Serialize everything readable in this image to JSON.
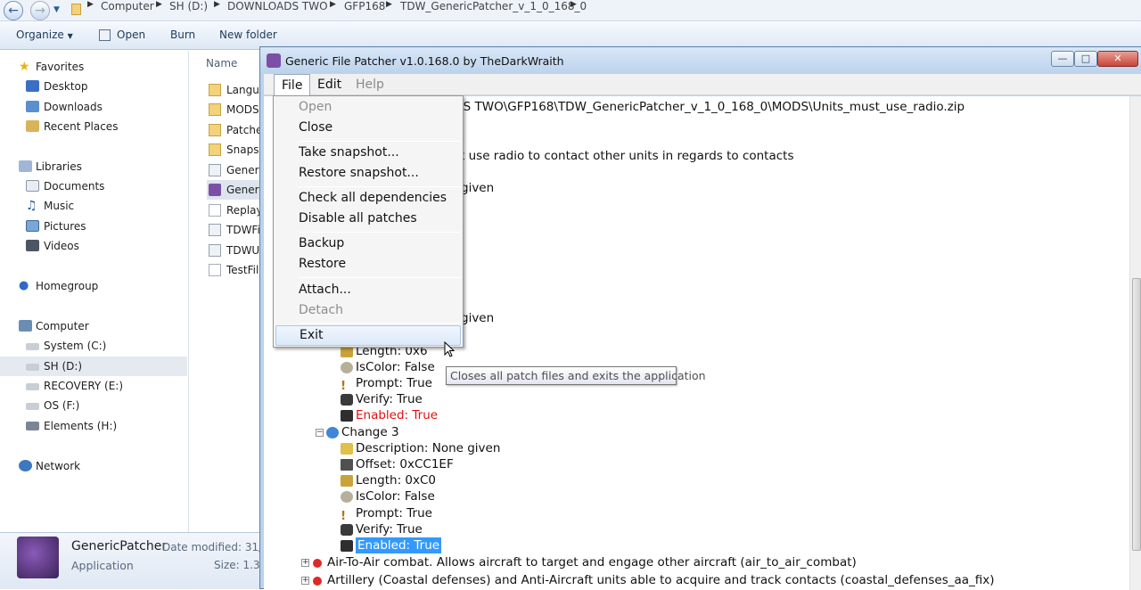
{
  "explorer": {
    "breadcrumb": [
      "Computer",
      "SH (D:)",
      "DOWNLOADS TWO",
      "GFP168",
      "TDW_GenericPatcher_v_1_0_168_0"
    ],
    "toolbar": {
      "organize": "Organize",
      "open": "Open",
      "burn": "Burn",
      "new_folder": "New folder"
    },
    "nav": {
      "favorites": "Favorites",
      "desktop": "Desktop",
      "downloads": "Downloads",
      "recent": "Recent Places",
      "libraries": "Libraries",
      "documents": "Documents",
      "music": "Music",
      "pictures": "Pictures",
      "videos": "Videos",
      "homegroup": "Homegroup",
      "computer": "Computer",
      "system_c": "System (C:)",
      "sh_d": "SH  (D:)",
      "recovery_e": "RECOVERY (E:)",
      "os_f": "OS (F:)",
      "elements_h": "Elements (H:)",
      "network": "Network"
    },
    "column_name": "Name",
    "files": [
      "Langua",
      "MODS",
      "Patche",
      "Snapsh",
      "Generi",
      "Generi",
      "Replay",
      "TDWFi",
      "TDWU",
      "TestFil"
    ],
    "details": {
      "name": "GenericPatcher",
      "type": "Application",
      "modified_label": "Date modified: 31/0",
      "size_label": "Size: 1.38"
    }
  },
  "app": {
    "title": "Generic File Patcher v1.0.168.0 by TheDarkWraith",
    "menubar": {
      "file": "File",
      "edit": "Edit",
      "help": "Help"
    },
    "file_menu": {
      "open": "Open",
      "close": "Close",
      "take_snapshot": "Take snapshot...",
      "restore_snapshot": "Restore snapshot...",
      "check_deps": "Check all dependencies",
      "disable_patches": "Disable all patches",
      "backup": "Backup",
      "restore": "Restore",
      "attach": "Attach...",
      "detach": "Detach",
      "exit": "Exit"
    },
    "tooltip": "Closes all patch files and exits the application",
    "content": {
      "path_line": "OS TWO\\GFP168\\TDW_GenericPatcher_v_1_0_168_0\\MODS\\Units_must_use_radio.zip",
      "desc_line": "st use radio to contact other units in regards to contacts",
      "given1": "given",
      "given2": "given",
      "c2_length": "Length: 0x6",
      "c2_iscolor": "IsColor: False",
      "c2_prompt": "Prompt: True",
      "c2_verify": "Verify: True",
      "c2_enabled": "Enabled: True",
      "change3": "Change 3",
      "c3_description": "Description: None given",
      "c3_offset": "Offset: 0xCC1EF",
      "c3_length": "Length: 0xC0",
      "c3_iscolor": "IsColor: False",
      "c3_prompt": "Prompt: True",
      "c3_verify": "Verify: True",
      "c3_enabled": "Enabled: True",
      "patch_air": "Air-To-Air combat. Allows aircraft to target and engage other aircraft  (air_to_air_combat)",
      "patch_artillery": "Artillery (Coastal defenses) and Anti-Aircraft units able to acquire and track contacts  (coastal_defenses_aa_fix)"
    },
    "buttons": {
      "minimize": "—",
      "maximize": "□",
      "close": "✕"
    }
  },
  "colors": {
    "enabled_red": "#d11111",
    "selection": "#3399ff",
    "close_button": "#c9453a"
  }
}
